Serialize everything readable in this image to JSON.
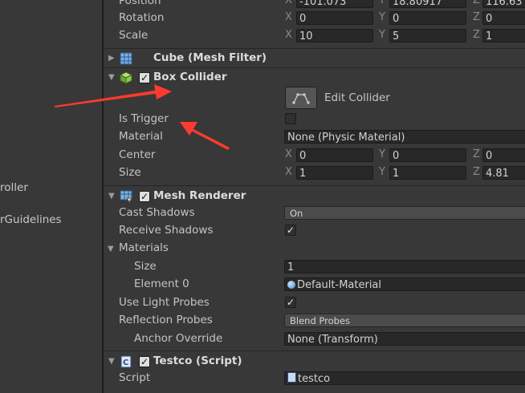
{
  "left_panel": {
    "items": [
      "roller",
      "rGuidelines"
    ]
  },
  "transform": {
    "position": {
      "label": "Position",
      "x": "-101.073",
      "y": "18.80917",
      "z": "116.63"
    },
    "rotation": {
      "label": "Rotation",
      "x": "0",
      "y": "0",
      "z": "0"
    },
    "scale": {
      "label": "Scale",
      "x": "10",
      "y": "5",
      "z": "1"
    }
  },
  "axes": {
    "x": "X",
    "y": "Y",
    "z": "Z"
  },
  "mesh_filter": {
    "title": "Cube (Mesh Filter)"
  },
  "box_collider": {
    "title": "Box Collider",
    "enabled": true,
    "edit_label": "Edit Collider",
    "is_trigger": {
      "label": "Is Trigger",
      "checked": false
    },
    "material": {
      "label": "Material",
      "value": "None (Physic Material)"
    },
    "center": {
      "label": "Center",
      "x": "0",
      "y": "0",
      "z": "0"
    },
    "size": {
      "label": "Size",
      "x": "1",
      "y": "1",
      "z": "4.81"
    }
  },
  "mesh_renderer": {
    "title": "Mesh Renderer",
    "enabled": true,
    "cast_shadows": {
      "label": "Cast Shadows",
      "value": "On"
    },
    "receive_shadows": {
      "label": "Receive Shadows",
      "checked": true
    },
    "materials": {
      "label": "Materials",
      "size_label": "Size",
      "size": "1",
      "element_label": "Element 0",
      "element_value": "Default-Material"
    },
    "use_light_probes": {
      "label": "Use Light Probes",
      "checked": true
    },
    "reflection_probes": {
      "label": "Reflection Probes",
      "value": "Blend Probes"
    },
    "anchor_override": {
      "label": "Anchor Override",
      "value": "None (Transform)"
    }
  },
  "script_component": {
    "title": "Testco (Script)",
    "enabled": true,
    "script_label": "Script",
    "script_value": "testco"
  },
  "colors": {
    "annotation_arrow": "#ff3b30",
    "background": "#383838",
    "field": "#282828"
  }
}
